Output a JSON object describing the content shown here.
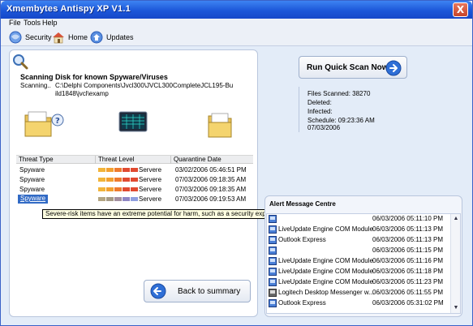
{
  "window": {
    "title": "Xmembytes Antispy XP V1.1",
    "close_glyph": "X"
  },
  "menu": {
    "file": "File",
    "tools": "Tools",
    "help": "Help"
  },
  "toolbar": {
    "security": "Security",
    "home": "Home",
    "updates": "Updates"
  },
  "scan": {
    "title": "Scanning Disk for known Spyware/Viruses",
    "scanning_label": "Scanning..",
    "scanning_path": "C:\\Delphi Components\\Jvcl300\\JVCL300CompleteJCL195-Build1848\\jvcl\\examp"
  },
  "threats": {
    "columns": [
      "Threat Type",
      "Threat Level",
      "Quarantine Date"
    ],
    "rows": [
      {
        "type": "Spyware",
        "level": "Servere",
        "date": "03/02/2006 05:46:51 PM",
        "selected": false
      },
      {
        "type": "Spyware",
        "level": "Servere",
        "date": "07/03/2006 09:18:35 AM",
        "selected": false
      },
      {
        "type": "Spyware",
        "level": "Servere",
        "date": "07/03/2006 09:18:35 AM",
        "selected": false
      },
      {
        "type": "Spyware",
        "level": "Servere",
        "date": "07/03/2006 09:19:53 AM",
        "selected": true
      }
    ],
    "tooltip": "Severe-risk items have an extreme potential for harm, such as a security exploit, and should be removed."
  },
  "buttons": {
    "back": "Back to summary",
    "quick_scan": "Run Quick Scan Now"
  },
  "stats": {
    "files_scanned": "Files Scanned: 38270",
    "deleted": "Deleted:",
    "infected": "Infected:",
    "schedule": "Schedule: 09:23:36 AM 07/03/2006"
  },
  "alerts": {
    "title": "Alert Message Centre",
    "items": [
      {
        "name": "",
        "date": "06/03/2006 05:11:10 PM"
      },
      {
        "name": "LiveUpdate Engine COM Module",
        "date": "06/03/2006 05:11:13 PM"
      },
      {
        "name": "Outlook Express",
        "date": "06/03/2006 05:11:13 PM"
      },
      {
        "name": "",
        "date": "06/03/2006 05:11:15 PM"
      },
      {
        "name": "LiveUpdate Engine COM Module",
        "date": "06/03/2006 05:11:16 PM"
      },
      {
        "name": "LiveUpdate Engine COM Module",
        "date": "06/03/2006 05:11:18 PM"
      },
      {
        "name": "LiveUpdate Engine COM Module",
        "date": "06/03/2006 05:11:23 PM"
      },
      {
        "name": "Logitech Desktop Messenger w...",
        "date": "06/03/2006 05:11:55 PM"
      },
      {
        "name": "Outlook Express",
        "date": "06/03/2006 05:31:02 PM"
      }
    ]
  },
  "colors": {
    "title_bar": "#1c57d9",
    "accent_blue": "#2f6fd6",
    "level_orange": "#f0a030",
    "level_red": "#e04a30"
  }
}
